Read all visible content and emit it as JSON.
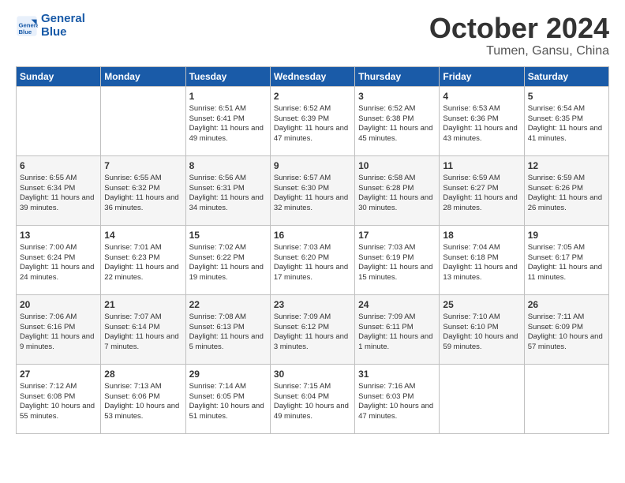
{
  "header": {
    "logo_general": "General",
    "logo_blue": "Blue",
    "month": "October 2024",
    "location": "Tumen, Gansu, China"
  },
  "days_of_week": [
    "Sunday",
    "Monday",
    "Tuesday",
    "Wednesday",
    "Thursday",
    "Friday",
    "Saturday"
  ],
  "weeks": [
    [
      {
        "day": "",
        "sunrise": "",
        "sunset": "",
        "daylight": ""
      },
      {
        "day": "",
        "sunrise": "",
        "sunset": "",
        "daylight": ""
      },
      {
        "day": "1",
        "sunrise": "Sunrise: 6:51 AM",
        "sunset": "Sunset: 6:41 PM",
        "daylight": "Daylight: 11 hours and 49 minutes."
      },
      {
        "day": "2",
        "sunrise": "Sunrise: 6:52 AM",
        "sunset": "Sunset: 6:39 PM",
        "daylight": "Daylight: 11 hours and 47 minutes."
      },
      {
        "day": "3",
        "sunrise": "Sunrise: 6:52 AM",
        "sunset": "Sunset: 6:38 PM",
        "daylight": "Daylight: 11 hours and 45 minutes."
      },
      {
        "day": "4",
        "sunrise": "Sunrise: 6:53 AM",
        "sunset": "Sunset: 6:36 PM",
        "daylight": "Daylight: 11 hours and 43 minutes."
      },
      {
        "day": "5",
        "sunrise": "Sunrise: 6:54 AM",
        "sunset": "Sunset: 6:35 PM",
        "daylight": "Daylight: 11 hours and 41 minutes."
      }
    ],
    [
      {
        "day": "6",
        "sunrise": "Sunrise: 6:55 AM",
        "sunset": "Sunset: 6:34 PM",
        "daylight": "Daylight: 11 hours and 39 minutes."
      },
      {
        "day": "7",
        "sunrise": "Sunrise: 6:55 AM",
        "sunset": "Sunset: 6:32 PM",
        "daylight": "Daylight: 11 hours and 36 minutes."
      },
      {
        "day": "8",
        "sunrise": "Sunrise: 6:56 AM",
        "sunset": "Sunset: 6:31 PM",
        "daylight": "Daylight: 11 hours and 34 minutes."
      },
      {
        "day": "9",
        "sunrise": "Sunrise: 6:57 AM",
        "sunset": "Sunset: 6:30 PM",
        "daylight": "Daylight: 11 hours and 32 minutes."
      },
      {
        "day": "10",
        "sunrise": "Sunrise: 6:58 AM",
        "sunset": "Sunset: 6:28 PM",
        "daylight": "Daylight: 11 hours and 30 minutes."
      },
      {
        "day": "11",
        "sunrise": "Sunrise: 6:59 AM",
        "sunset": "Sunset: 6:27 PM",
        "daylight": "Daylight: 11 hours and 28 minutes."
      },
      {
        "day": "12",
        "sunrise": "Sunrise: 6:59 AM",
        "sunset": "Sunset: 6:26 PM",
        "daylight": "Daylight: 11 hours and 26 minutes."
      }
    ],
    [
      {
        "day": "13",
        "sunrise": "Sunrise: 7:00 AM",
        "sunset": "Sunset: 6:24 PM",
        "daylight": "Daylight: 11 hours and 24 minutes."
      },
      {
        "day": "14",
        "sunrise": "Sunrise: 7:01 AM",
        "sunset": "Sunset: 6:23 PM",
        "daylight": "Daylight: 11 hours and 22 minutes."
      },
      {
        "day": "15",
        "sunrise": "Sunrise: 7:02 AM",
        "sunset": "Sunset: 6:22 PM",
        "daylight": "Daylight: 11 hours and 19 minutes."
      },
      {
        "day": "16",
        "sunrise": "Sunrise: 7:03 AM",
        "sunset": "Sunset: 6:20 PM",
        "daylight": "Daylight: 11 hours and 17 minutes."
      },
      {
        "day": "17",
        "sunrise": "Sunrise: 7:03 AM",
        "sunset": "Sunset: 6:19 PM",
        "daylight": "Daylight: 11 hours and 15 minutes."
      },
      {
        "day": "18",
        "sunrise": "Sunrise: 7:04 AM",
        "sunset": "Sunset: 6:18 PM",
        "daylight": "Daylight: 11 hours and 13 minutes."
      },
      {
        "day": "19",
        "sunrise": "Sunrise: 7:05 AM",
        "sunset": "Sunset: 6:17 PM",
        "daylight": "Daylight: 11 hours and 11 minutes."
      }
    ],
    [
      {
        "day": "20",
        "sunrise": "Sunrise: 7:06 AM",
        "sunset": "Sunset: 6:16 PM",
        "daylight": "Daylight: 11 hours and 9 minutes."
      },
      {
        "day": "21",
        "sunrise": "Sunrise: 7:07 AM",
        "sunset": "Sunset: 6:14 PM",
        "daylight": "Daylight: 11 hours and 7 minutes."
      },
      {
        "day": "22",
        "sunrise": "Sunrise: 7:08 AM",
        "sunset": "Sunset: 6:13 PM",
        "daylight": "Daylight: 11 hours and 5 minutes."
      },
      {
        "day": "23",
        "sunrise": "Sunrise: 7:09 AM",
        "sunset": "Sunset: 6:12 PM",
        "daylight": "Daylight: 11 hours and 3 minutes."
      },
      {
        "day": "24",
        "sunrise": "Sunrise: 7:09 AM",
        "sunset": "Sunset: 6:11 PM",
        "daylight": "Daylight: 11 hours and 1 minute."
      },
      {
        "day": "25",
        "sunrise": "Sunrise: 7:10 AM",
        "sunset": "Sunset: 6:10 PM",
        "daylight": "Daylight: 10 hours and 59 minutes."
      },
      {
        "day": "26",
        "sunrise": "Sunrise: 7:11 AM",
        "sunset": "Sunset: 6:09 PM",
        "daylight": "Daylight: 10 hours and 57 minutes."
      }
    ],
    [
      {
        "day": "27",
        "sunrise": "Sunrise: 7:12 AM",
        "sunset": "Sunset: 6:08 PM",
        "daylight": "Daylight: 10 hours and 55 minutes."
      },
      {
        "day": "28",
        "sunrise": "Sunrise: 7:13 AM",
        "sunset": "Sunset: 6:06 PM",
        "daylight": "Daylight: 10 hours and 53 minutes."
      },
      {
        "day": "29",
        "sunrise": "Sunrise: 7:14 AM",
        "sunset": "Sunset: 6:05 PM",
        "daylight": "Daylight: 10 hours and 51 minutes."
      },
      {
        "day": "30",
        "sunrise": "Sunrise: 7:15 AM",
        "sunset": "Sunset: 6:04 PM",
        "daylight": "Daylight: 10 hours and 49 minutes."
      },
      {
        "day": "31",
        "sunrise": "Sunrise: 7:16 AM",
        "sunset": "Sunset: 6:03 PM",
        "daylight": "Daylight: 10 hours and 47 minutes."
      },
      {
        "day": "",
        "sunrise": "",
        "sunset": "",
        "daylight": ""
      },
      {
        "day": "",
        "sunrise": "",
        "sunset": "",
        "daylight": ""
      }
    ]
  ]
}
